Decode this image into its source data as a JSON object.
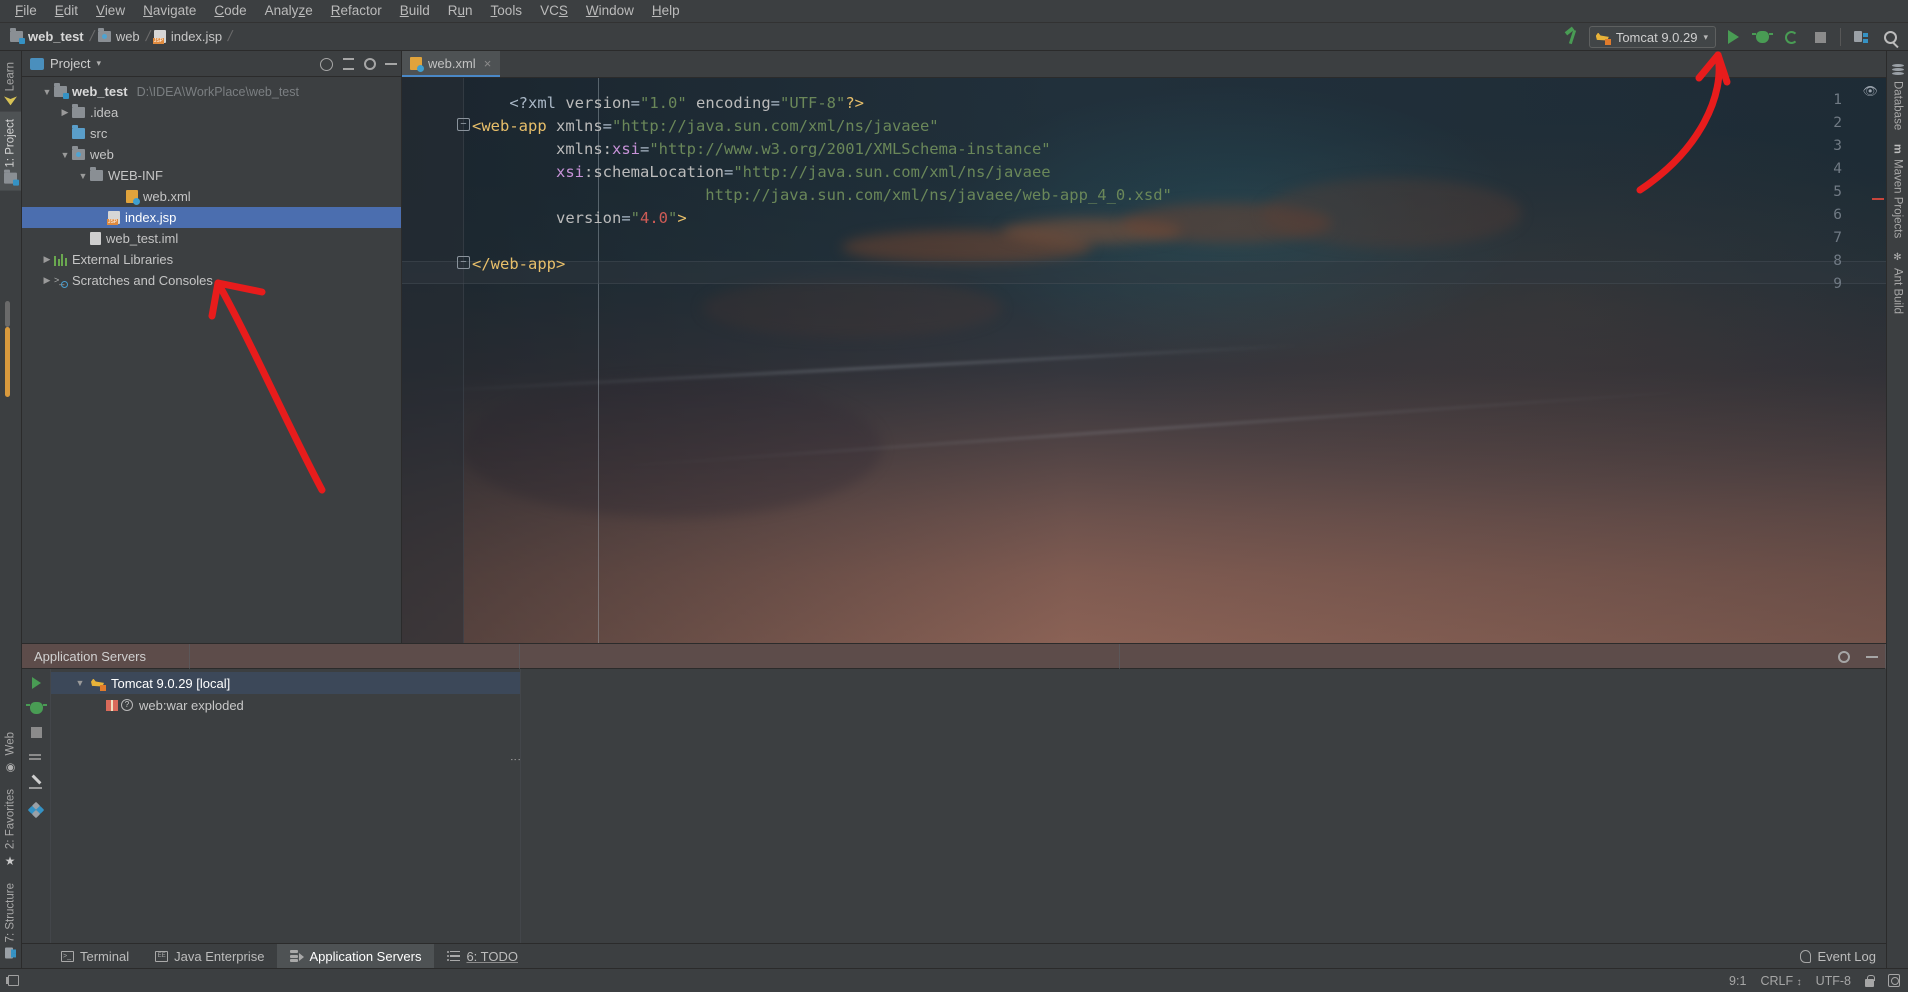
{
  "menubar": {
    "items": [
      {
        "label": "File",
        "mnemonic": "F"
      },
      {
        "label": "Edit",
        "mnemonic": "E"
      },
      {
        "label": "View",
        "mnemonic": "V"
      },
      {
        "label": "Navigate",
        "mnemonic": "N"
      },
      {
        "label": "Code",
        "mnemonic": "C"
      },
      {
        "label": "Analyze",
        "mnemonic": "z"
      },
      {
        "label": "Refactor",
        "mnemonic": "R"
      },
      {
        "label": "Build",
        "mnemonic": "B"
      },
      {
        "label": "Run",
        "mnemonic": "u"
      },
      {
        "label": "Tools",
        "mnemonic": "T"
      },
      {
        "label": "VCS",
        "mnemonic": "S"
      },
      {
        "label": "Window",
        "mnemonic": "W"
      },
      {
        "label": "Help",
        "mnemonic": "H"
      }
    ]
  },
  "navbar": {
    "breadcrumbs": [
      {
        "label": "web_test",
        "icon": "module-folder-icon"
      },
      {
        "label": "web",
        "icon": "web-folder-icon"
      },
      {
        "label": "index.jsp",
        "icon": "jsp-file-icon"
      }
    ],
    "build_icon": "build-hammer-icon",
    "run_config": {
      "label": "Tomcat 9.0.29",
      "icon": "tomcat-cat-icon",
      "chevron": "▾"
    },
    "actions": [
      {
        "name": "run-button",
        "icon": "run-play-icon"
      },
      {
        "name": "debug-button",
        "icon": "debug-bug-icon"
      },
      {
        "name": "rerun-button",
        "icon": "rerun-icon"
      },
      {
        "name": "stop-button",
        "icon": "stop-square-icon"
      },
      {
        "name": "project-structure-button",
        "icon": "project-structure-icon"
      },
      {
        "name": "search-everywhere-button",
        "icon": "search-icon"
      }
    ]
  },
  "left_stripe": {
    "tabs": [
      {
        "label": "Learn",
        "icon": "learn-icon",
        "selected": false
      },
      {
        "label": "1: Project",
        "icon": "project-folder-icon",
        "selected": true
      },
      {
        "label": "Web",
        "icon": "web-globe-icon",
        "selected": false
      },
      {
        "label": "2: Favorites",
        "icon": "star-icon",
        "selected": false
      },
      {
        "label": "7: Structure",
        "icon": "structure-icon",
        "selected": false
      }
    ]
  },
  "right_stripe": {
    "tabs": [
      {
        "label": "Database",
        "icon": "database-icon"
      },
      {
        "label": "Maven Projects",
        "icon": "maven-icon"
      },
      {
        "label": "Ant Build",
        "icon": "ant-icon"
      }
    ]
  },
  "project_panel": {
    "title": "Project",
    "chevron": "▾",
    "toolbar": [
      {
        "name": "locate-file-button",
        "icon": "crosshair-icon"
      },
      {
        "name": "collapse-all-button",
        "icon": "collapse-all-icon"
      },
      {
        "name": "settings-button",
        "icon": "gear-icon"
      },
      {
        "name": "hide-button",
        "icon": "minus-icon"
      }
    ],
    "tree": [
      {
        "label": "web_test",
        "path": "D:\\IDEA\\WorkPlace\\web_test",
        "indent": 0,
        "arrow": "▼",
        "icon": "module-folder-icon",
        "bold": true,
        "selected": false
      },
      {
        "label": ".idea",
        "path": "",
        "indent": 1,
        "arrow": "▶",
        "icon": "folder-icon",
        "bold": false,
        "selected": false
      },
      {
        "label": "src",
        "path": "",
        "indent": 1,
        "arrow": "",
        "icon": "source-folder-icon",
        "bold": false,
        "selected": false
      },
      {
        "label": "web",
        "path": "",
        "indent": 1,
        "arrow": "▼",
        "icon": "web-folder-icon",
        "bold": false,
        "selected": false
      },
      {
        "label": "WEB-INF",
        "path": "",
        "indent": 2,
        "arrow": "▼",
        "icon": "folder-icon",
        "bold": false,
        "selected": false
      },
      {
        "label": "web.xml",
        "path": "",
        "indent": 3,
        "arrow": "",
        "icon": "xml-file-icon",
        "bold": false,
        "selected": false
      },
      {
        "label": "index.jsp",
        "path": "",
        "indent": 2,
        "arrow": "",
        "icon": "jsp-file-icon",
        "bold": false,
        "selected": true
      },
      {
        "label": "web_test.iml",
        "path": "",
        "indent": 1,
        "arrow": "",
        "icon": "iml-file-icon",
        "bold": false,
        "selected": false
      },
      {
        "label": "External Libraries",
        "path": "",
        "indent": 0,
        "arrow": "▶",
        "icon": "libraries-icon",
        "bold": false,
        "selected": false
      },
      {
        "label": "Scratches and Consoles",
        "path": "",
        "indent": 0,
        "arrow": "▶",
        "icon": "scratches-icon",
        "bold": false,
        "selected": false
      }
    ]
  },
  "editor": {
    "tabs": [
      {
        "label": "web.xml",
        "icon": "xml-file-icon",
        "close": "×",
        "active": true
      }
    ],
    "lines": [
      {
        "num": "1",
        "fold": "",
        "tokens": [
          {
            "t": "    ",
            "c": "c-text"
          },
          {
            "t": "<?xml ",
            "c": "c-punct"
          },
          {
            "t": "version",
            "c": "c-attr"
          },
          {
            "t": "=",
            "c": "c-punct"
          },
          {
            "t": "\"1.0\"",
            "c": "c-str"
          },
          {
            "t": " ",
            "c": "c-text"
          },
          {
            "t": "encoding",
            "c": "c-attr"
          },
          {
            "t": "=",
            "c": "c-punct"
          },
          {
            "t": "\"UTF-8\"",
            "c": "c-str"
          },
          {
            "t": "?>",
            "c": "c-tag"
          }
        ]
      },
      {
        "num": "2",
        "fold": "−",
        "tokens": [
          {
            "t": "",
            "c": "c-text"
          },
          {
            "t": "<web-app",
            "c": "c-tag"
          },
          {
            "t": " ",
            "c": "c-text"
          },
          {
            "t": "xmlns",
            "c": "c-attr"
          },
          {
            "t": "=",
            "c": "c-punct"
          },
          {
            "t": "\"http://java.sun.com/xml/ns/javaee\"",
            "c": "c-str"
          }
        ]
      },
      {
        "num": "3",
        "fold": "",
        "tokens": [
          {
            "t": "         ",
            "c": "c-text"
          },
          {
            "t": "xmlns:",
            "c": "c-attr"
          },
          {
            "t": "xsi",
            "c": "c-ns"
          },
          {
            "t": "=",
            "c": "c-punct"
          },
          {
            "t": "\"http://www.w3.org/2001/XMLSchema-instance\"",
            "c": "c-str"
          }
        ]
      },
      {
        "num": "4",
        "fold": "",
        "tokens": [
          {
            "t": "         ",
            "c": "c-text"
          },
          {
            "t": "xsi",
            "c": "c-ns"
          },
          {
            "t": ":schemaLocation",
            "c": "c-attr"
          },
          {
            "t": "=",
            "c": "c-punct"
          },
          {
            "t": "\"http://java.sun.com/xml/ns/javaee",
            "c": "c-str"
          }
        ]
      },
      {
        "num": "5",
        "fold": "",
        "tokens": [
          {
            "t": "                         ",
            "c": "c-text"
          },
          {
            "t": "http://java.sun.com/xml/ns/javaee/web-app_4_0.xsd\"",
            "c": "c-str"
          }
        ]
      },
      {
        "num": "6",
        "fold": "",
        "tokens": [
          {
            "t": "         ",
            "c": "c-text"
          },
          {
            "t": "version",
            "c": "c-attr"
          },
          {
            "t": "=",
            "c": "c-punct"
          },
          {
            "t": "\"",
            "c": "c-str"
          },
          {
            "t": "4.0",
            "c": "c-num"
          },
          {
            "t": "\"",
            "c": "c-str"
          },
          {
            "t": ">",
            "c": "c-tag"
          }
        ]
      },
      {
        "num": "7",
        "fold": "",
        "tokens": []
      },
      {
        "num": "8",
        "fold": "−",
        "tokens": [
          {
            "t": "",
            "c": "c-text"
          },
          {
            "t": "</web-app>",
            "c": "c-tag"
          }
        ]
      },
      {
        "num": "9",
        "fold": "",
        "tokens": []
      }
    ],
    "inspection_icon": "inspections-eye-icon"
  },
  "run_panel": {
    "title": "Application Servers",
    "toolbar": [
      {
        "name": "settings-button",
        "icon": "gear-icon"
      },
      {
        "name": "hide-button",
        "icon": "minus-icon"
      }
    ],
    "gutter_actions": [
      {
        "name": "run-button",
        "icon": "run-play-icon"
      },
      {
        "name": "debug-button",
        "icon": "debug-bug-icon"
      },
      {
        "name": "stop-button",
        "icon": "stop-square-icon"
      },
      {
        "name": "deploy-button",
        "icon": "deploy-arrows-icon"
      },
      {
        "name": "edit-configuration-button",
        "icon": "pencil-icon"
      },
      {
        "name": "artifacts-button",
        "icon": "diamond-icon"
      }
    ],
    "tree": [
      {
        "label": "Tomcat 9.0.29 [local]",
        "arrow": "▼",
        "icon": "tomcat-cat-icon",
        "indent": 0,
        "selected": true
      },
      {
        "label": "web:war exploded",
        "arrow": "",
        "icon": "artifact-gift-icon",
        "indent": 1,
        "selected": false,
        "extra_icon": "question-icon"
      }
    ]
  },
  "toolwindow_bar": {
    "tabs": [
      {
        "label": "Terminal",
        "icon": "terminal-icon",
        "selected": false
      },
      {
        "label": "Java Enterprise",
        "icon": "java-enterprise-icon",
        "selected": false
      },
      {
        "label": "Application Servers",
        "icon": "application-servers-icon",
        "selected": true
      },
      {
        "label": "6: TODO",
        "icon": "todo-icon",
        "selected": false,
        "mnemonic": "6"
      }
    ],
    "event_log": {
      "label": "Event Log",
      "icon": "event-log-icon"
    }
  },
  "statusbar": {
    "caret_position": "9:1",
    "line_separator": "CRLF",
    "line_separator_arrows": "↕",
    "encoding": "UTF-8",
    "lock_icon": "read-only-lock-icon",
    "git_icon": "vcs-branch-icon",
    "collapse_icon": "hide-toolwindows-icon"
  },
  "annotations": {
    "color": "#e81c1c",
    "arrows": [
      {
        "name": "arrow-to-run-button",
        "description": "red arrow pointing to run button in toolbar"
      },
      {
        "name": "arrow-to-index-jsp",
        "description": "red arrow pointing to index.jsp in project tree"
      }
    ]
  },
  "colors": {
    "accent_blue": "#4b6eaf",
    "run_green": "#499c54",
    "panel_bg": "#3c3f41",
    "editor_bg": "#2b2b2b",
    "annotation_red": "#e81c1c"
  }
}
